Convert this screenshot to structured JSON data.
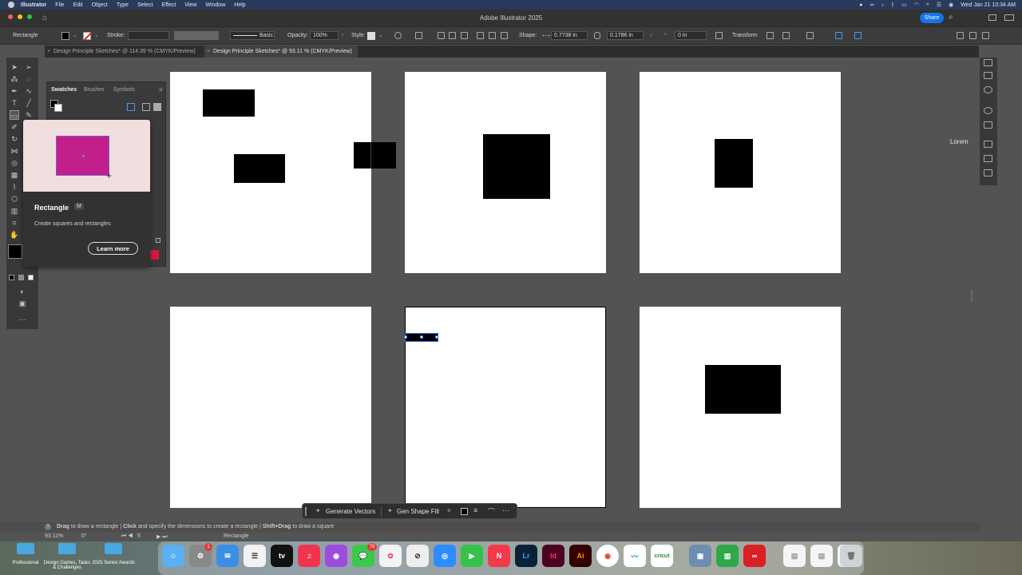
{
  "menubar": {
    "items": [
      "Illustrator",
      "File",
      "Edit",
      "Object",
      "Type",
      "Select",
      "Effect",
      "View",
      "Window",
      "Help"
    ],
    "datetime": "Wed Jan 21  10:34 AM"
  },
  "titlebar": {
    "title": "Adobe Illustrator 2025",
    "share_label": "Share"
  },
  "controlbar": {
    "object_type": "Rectangle",
    "stroke_label": "Stroke:",
    "brush_label": "Basic",
    "opacity_label": "Opacity:",
    "opacity_value": "100%",
    "style_label": "Style:",
    "shape_label": "Shape:",
    "width_value": "0.7738 in",
    "height_value": "0.1786 in",
    "corner_value": "0 in",
    "transform_label": "Transform"
  },
  "tabs": [
    {
      "label": "Design Principle Sketches* @ 114.39 % (CMYK/Preview)",
      "active": false
    },
    {
      "label": "Design Principle Sketches* @ 93.11 % (CMYK/Preview)",
      "active": true
    }
  ],
  "swatches_panel": {
    "tabs": [
      "Swatches",
      "Brushes",
      "Symbols"
    ]
  },
  "tooltip": {
    "title": "Rectangle",
    "shortcut": "M",
    "description": "Create squares and rectangles",
    "learn_more_label": "Learn more"
  },
  "canvas": {
    "lorem_text": "Lorem"
  },
  "taskbar": {
    "generate_vectors_label": "Generate Vectors",
    "gen_shape_fill_label": "Gen Shape Fill"
  },
  "statusbar": {
    "hint_drag": "Drag",
    "hint_drag_text": " to draw a rectangle  |  ",
    "hint_click": "Click",
    "hint_click_text": " and specify the dimensions to create a rectangle  |  ",
    "hint_shift": "Shift+Drag",
    "hint_shift_text": " to draw a square",
    "zoom_value": "93.11%",
    "rotation_value": "0°",
    "artboard_number": "5",
    "current_tool": "Rectangle"
  },
  "desktop": {
    "icons": [
      "Professional",
      "Design Games, Tasks & Challenges",
      "2025 Senior Awards"
    ]
  },
  "dock": {
    "apps": [
      "Finder",
      "Launchpad",
      "Mail",
      "Reminders",
      "TV",
      "Music",
      "Podcasts",
      "Messages",
      "Photos",
      "Safari",
      "Zoom",
      "FaceTime",
      "News",
      "Lightroom",
      "InDesign",
      "Illustrator",
      "Chrome",
      "Freeform",
      "Cricut",
      "Preview",
      "Numbers",
      "Creative Cloud",
      "Doc1",
      "Doc2",
      "Doc3",
      "Trash"
    ],
    "messages_badge": "76",
    "launchpad_badge": "1",
    "tv_label": "tv",
    "lightroom_label": "Lr",
    "indesign_label": "Id",
    "illustrator_label": "Ai",
    "cricut_label": "cricut"
  },
  "colors": {
    "accent": "#1473e6",
    "tooltip_preview_bg": "#f1dede",
    "tooltip_rect_fill": "#c21f8b"
  }
}
